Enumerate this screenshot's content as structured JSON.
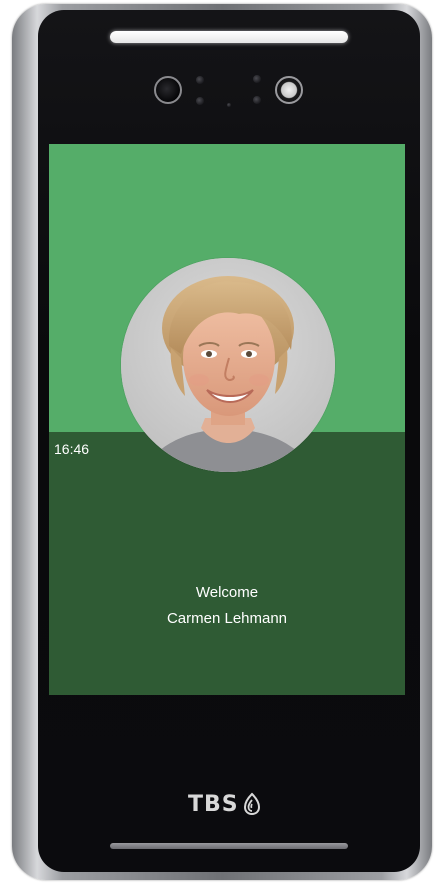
{
  "screen": {
    "time": "16:46",
    "greeting": "Welcome",
    "user_name": "Carmen Lehmann"
  },
  "device": {
    "brand": "TBS",
    "brand_icon": "fingerprint-icon"
  },
  "colors": {
    "screen_top": "#55ad69",
    "screen_bottom": "#2f5b34",
    "text": "#ffffff"
  }
}
